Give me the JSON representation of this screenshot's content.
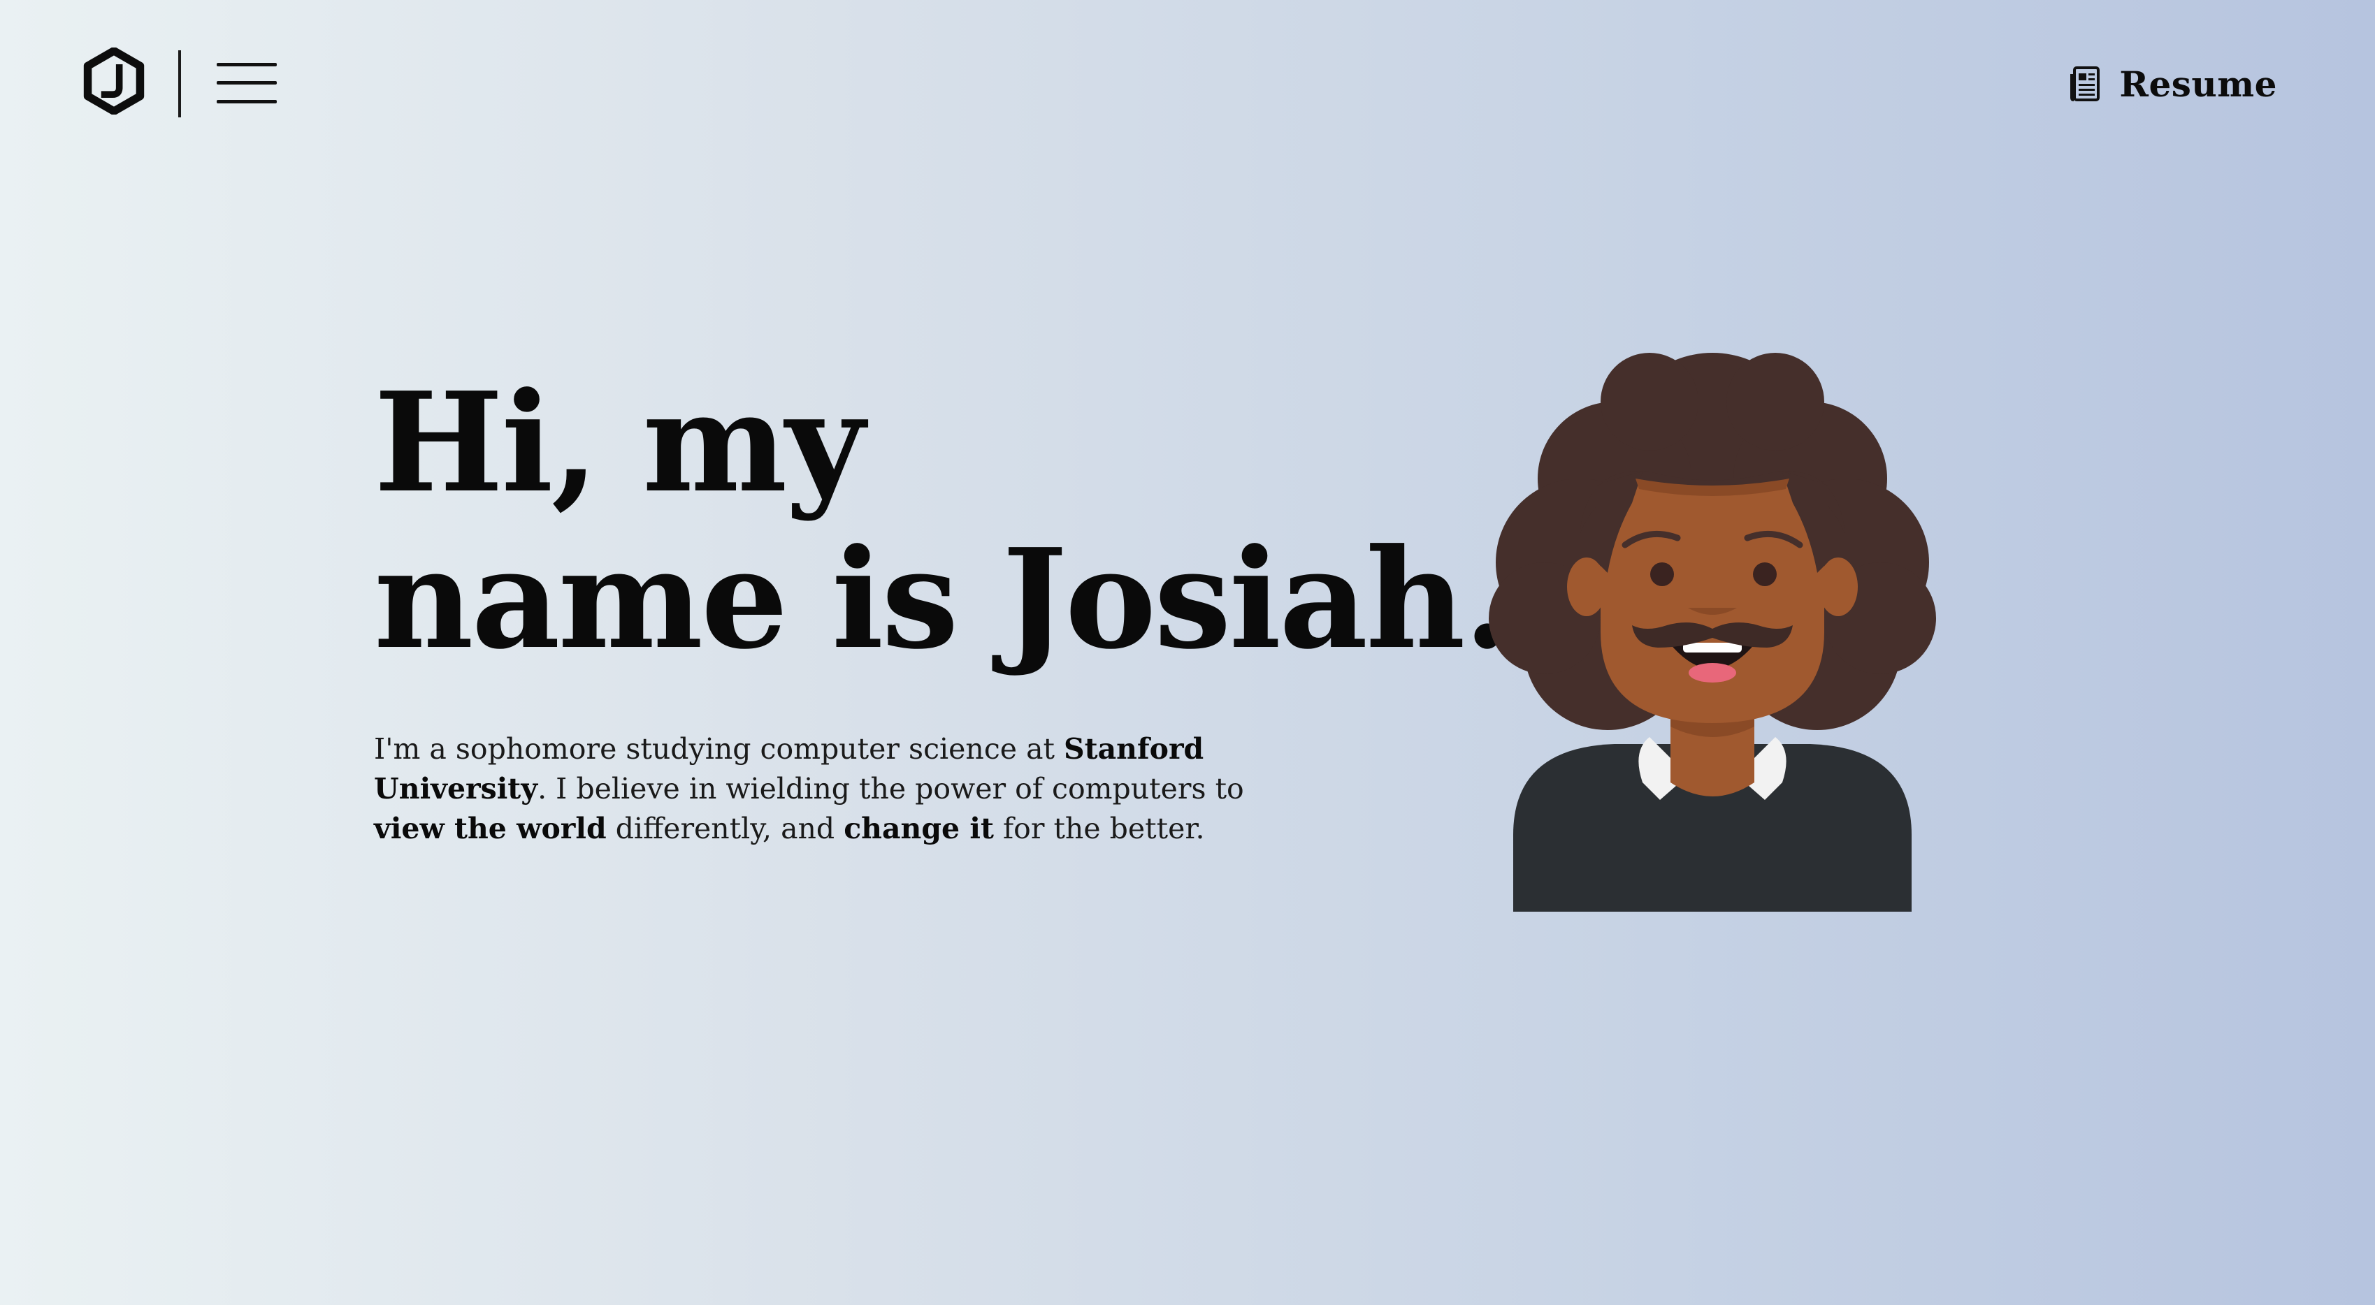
{
  "header": {
    "logo_name": "hexagon-j-logo",
    "menu_icon": "hamburger-menu-icon",
    "resume_icon": "document-icon",
    "resume_label": "Resume"
  },
  "hero": {
    "title_line1": "Hi, my",
    "title_line2": "name is Josiah.",
    "intro": {
      "p1": "I'm a sophomore studying computer science at ",
      "b1": "Stanford University",
      "p2": ". I believe in wielding the power of computers to ",
      "b2": "view the world",
      "p3": " differently, and ",
      "b3": "change it",
      "p4": " for the better."
    }
  },
  "colors": {
    "skin": "#a0592f",
    "hair": "#452f2b",
    "shirt": "#2b2f33",
    "collar": "#f2f2f2"
  }
}
